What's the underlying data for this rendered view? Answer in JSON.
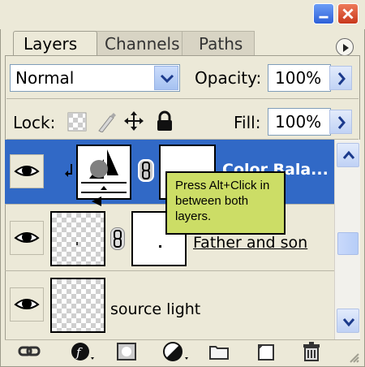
{
  "tabs": [
    "Layers",
    "Channels",
    "Paths"
  ],
  "blend_mode": "Normal",
  "opacity": {
    "label": "Opacity:",
    "value": "100%"
  },
  "lock": {
    "label": "Lock:"
  },
  "fill": {
    "label": "Fill:",
    "value": "100%"
  },
  "layers": [
    {
      "name": "Color Bala...",
      "selected": true,
      "visible": true
    },
    {
      "name": "Father and son",
      "selected": false,
      "visible": true
    },
    {
      "name": "source light",
      "selected": false,
      "visible": true
    }
  ],
  "tooltip": {
    "text": "Press Alt+Click in between both layers."
  },
  "icons": {
    "window": [
      "minimize-icon",
      "close-icon"
    ],
    "lock": [
      "lock-transparent-icon",
      "lock-image-icon",
      "lock-position-icon",
      "lock-all-icon"
    ],
    "bottom": [
      "link-icon",
      "layer-style-icon",
      "mask-icon",
      "adjustment-icon",
      "folder-icon",
      "new-layer-icon",
      "trash-icon"
    ]
  },
  "colors": {
    "selection": "#3169c6",
    "tooltip_bg": "#ccdd66",
    "panel_bg": "#ece9d8"
  }
}
